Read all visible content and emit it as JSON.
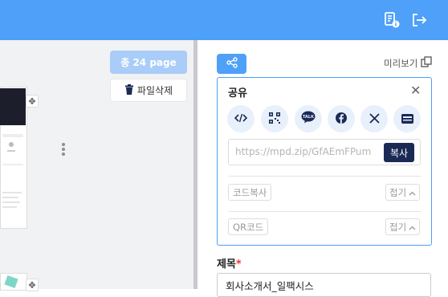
{
  "header": {
    "doc_info_icon": "document-info-icon",
    "logout_icon": "logout-icon"
  },
  "left": {
    "page_count_label": "총 24 page",
    "delete_file_label": "파일삭제"
  },
  "right": {
    "preview_label": "미리보기",
    "share": {
      "title": "공유",
      "buttons": [
        {
          "name": "embed-code-icon"
        },
        {
          "name": "qr-code-icon"
        },
        {
          "name": "kakaotalk-icon",
          "text": "TALK"
        },
        {
          "name": "facebook-icon"
        },
        {
          "name": "x-twitter-icon"
        },
        {
          "name": "card-icon"
        }
      ],
      "url_value": "https://mpd.zip/GfAEmFPum",
      "copy_label": "복사",
      "code_copy_label": "코드복사",
      "qr_code_label": "QR코드",
      "fold_label": "접기"
    },
    "title_label": "제목",
    "required_mark": "*",
    "title_value": "회사소개서_일팩시스"
  },
  "colors": {
    "accent": "#4ea0f8",
    "copy_button": "#1b2a55"
  }
}
